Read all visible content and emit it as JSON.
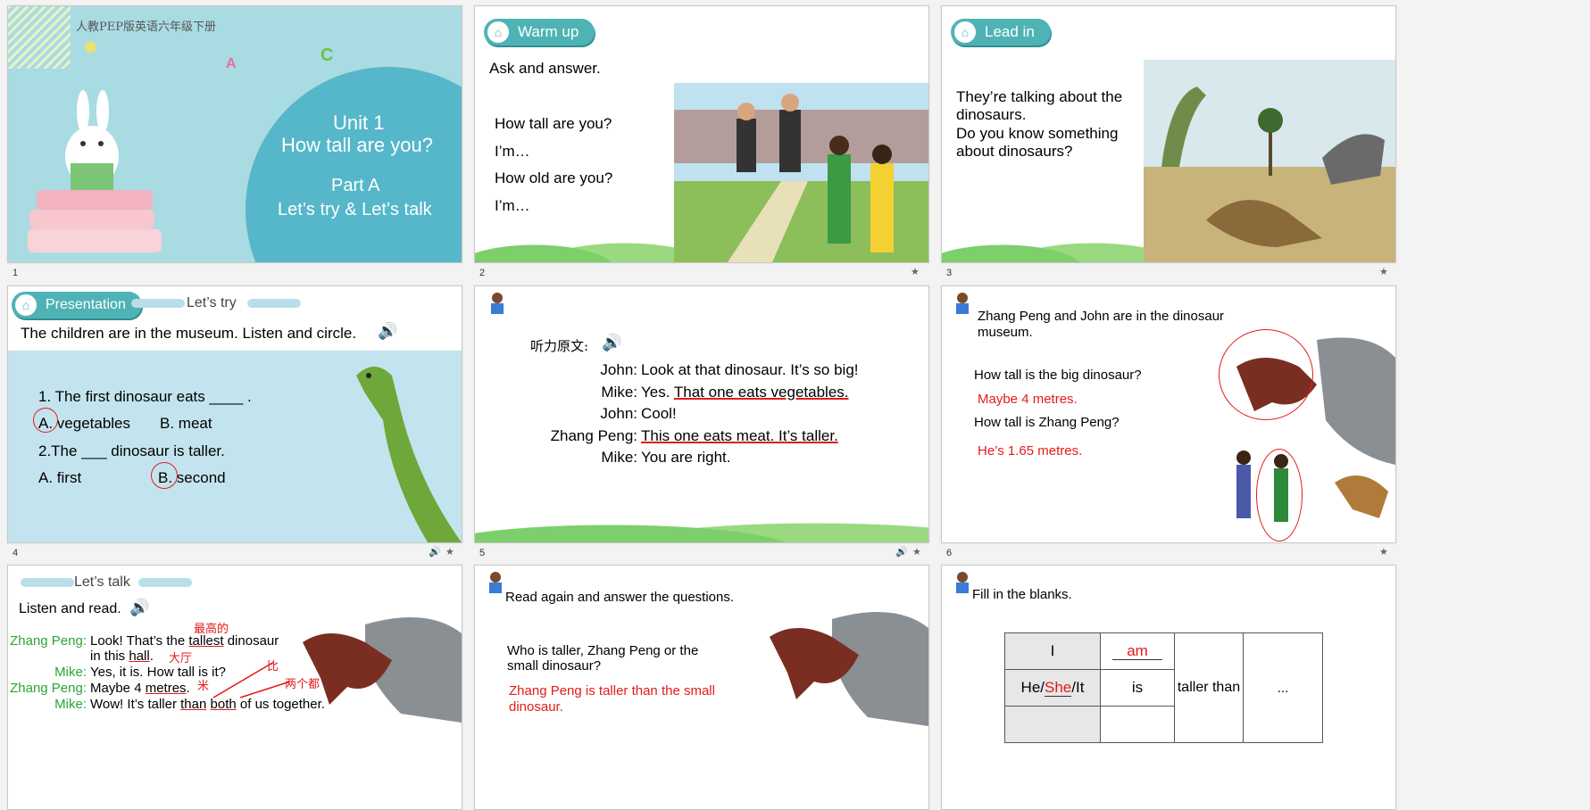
{
  "slides": [
    {
      "num": "1",
      "header": "人教PEP版英语六年级下册",
      "unit": "Unit 1",
      "title": "How tall are you?",
      "part": "Part A",
      "sub": "Let’s try & Let’s talk",
      "letters": [
        "A",
        "C"
      ]
    },
    {
      "num": "2",
      "tag": "Warm up",
      "prompt": "Ask and answer.",
      "q1": "How tall are you?",
      "a1": "I’m…",
      "q2": "How old are you?",
      "a2": "I’m…"
    },
    {
      "num": "3",
      "tag": "Lead in",
      "l1": "They’re talking about the",
      "l2": "dinosaurs.",
      "l3": "Do you know something",
      "l4": "about dinosaurs?"
    },
    {
      "num": "4",
      "tag": "Presentation",
      "section": "Let’s try",
      "instr": "The children are in the museum. Listen and circle.",
      "q1": "1.  The first dinosaur eats ____ .",
      "q1a": "A. vegetables",
      "q1b": "B. meat",
      "q2": "2.The ___ dinosaur is taller.",
      "q2a": "A. first",
      "q2b": "B. second"
    },
    {
      "num": "5",
      "label": "听力原文:",
      "lines": [
        {
          "sp": "John:",
          "tx": "Look at that dinosaur. It’s so big!"
        },
        {
          "sp": "Mike:",
          "pre": "Yes. ",
          "ul": "That one eats vegetables."
        },
        {
          "sp": "John:",
          "tx": "Cool!"
        },
        {
          "sp": "Zhang Peng:",
          "ul": "This one eats meat. It’s taller."
        },
        {
          "sp": "Mike:",
          "tx": "You are right."
        }
      ]
    },
    {
      "num": "6",
      "intro1": "Zhang Peng and John are in the dinosaur",
      "intro2": "museum.",
      "q1": "How tall is the big dinosaur?",
      "a1": "Maybe 4 metres.",
      "q2": "How tall is Zhang Peng?",
      "a2": "He’s 1.65 metres."
    },
    {
      "num": "7",
      "section": "Let’s talk",
      "instr": "Listen and read.",
      "n1": "最高的",
      "n2": "大厅",
      "n3": "比",
      "n4": "米",
      "n5": "两个都",
      "s1": "Zhang Peng:",
      "l1a": "Look! That’s the ",
      "l1b": "tallest",
      "l1c": " dinosaur",
      "l1d": "in this ",
      "l1e": "hall",
      ".": ".",
      "s2": "Mike:",
      "l2": "Yes, it is. How tall is it?",
      "s3": "Zhang Peng:",
      "l3a": "Maybe 4 ",
      "l3b": "metres",
      "l3c": ".",
      "s4": "Mike:",
      "l4a": "Wow! It’s taller ",
      "l4b": "than",
      "l4c": " ",
      "l4d": "both",
      "l4e": " of us together."
    },
    {
      "num": "8",
      "instr": "Read again and answer the questions.",
      "q1": "Who is taller, Zhang Peng or the",
      "q2": "small dinosaur?",
      "a1": "Zhang Peng is taller than the small",
      "a2": "dinosaur."
    },
    {
      "num": "9",
      "instr": "Fill in the blanks.",
      "r1c1": "I",
      "r1c2": "am",
      "r2a": "He/",
      "r2b": "She",
      "r2c": "/It",
      "r2d": "is",
      "mid": "taller than",
      "end": "..."
    }
  ],
  "icons": {
    "star": "★",
    "sound": "🔊"
  }
}
